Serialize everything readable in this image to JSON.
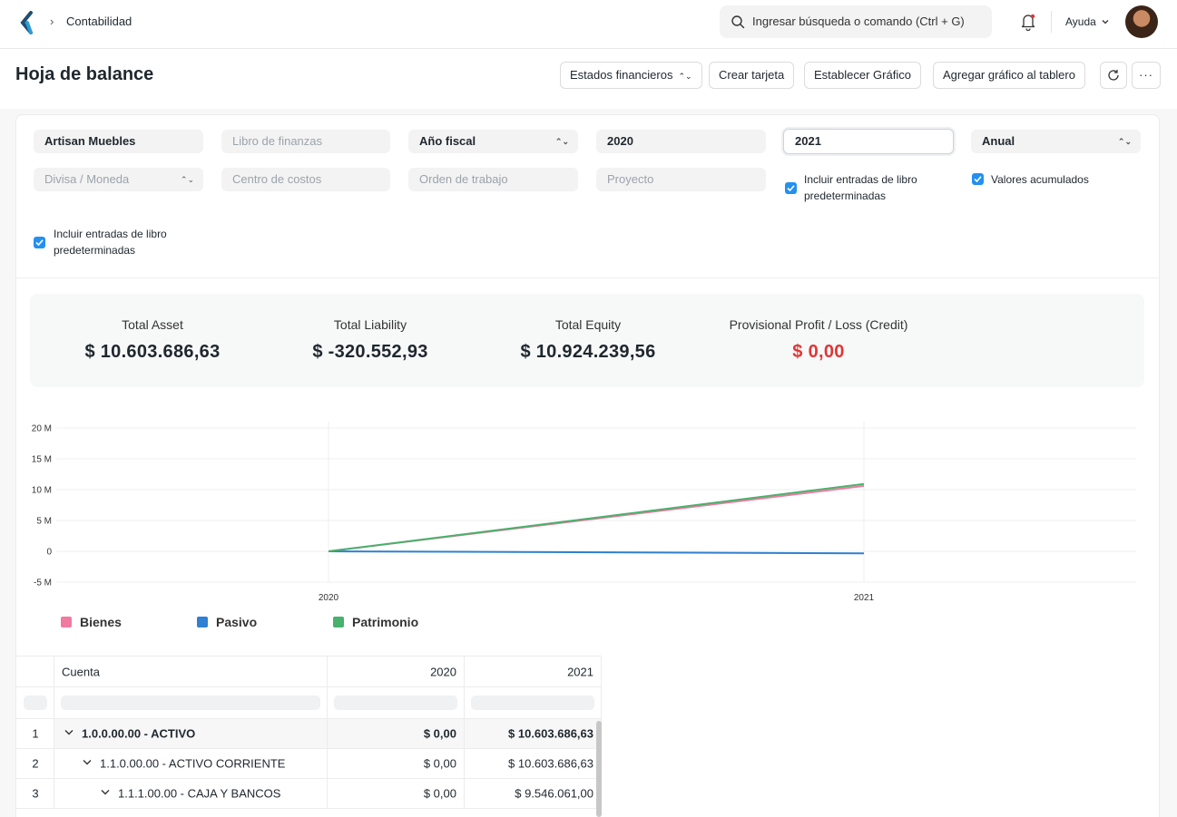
{
  "navbar": {
    "breadcrumb": "Contabilidad",
    "search_placeholder": "Ingresar búsqueda o comando (Ctrl + G)",
    "help_label": "Ayuda"
  },
  "page": {
    "title": "Hoja de balance",
    "buttons": {
      "financial_statements": "Estados financieros",
      "create_card": "Crear tarjeta",
      "set_chart": "Establecer Gráfico",
      "add_chart_dashboard": "Agregar gráfico al tablero"
    }
  },
  "filters": {
    "company": "Artisan Muebles",
    "finance_book_placeholder": "Libro de finanzas",
    "period_type": "Año fiscal",
    "from_year": "2020",
    "to_year": "2021",
    "periodicity": "Anual",
    "currency_placeholder": "Divisa / Moneda",
    "cost_center_placeholder": "Centro de costos",
    "work_order_placeholder": "Orden de trabajo",
    "project_placeholder": "Proyecto",
    "include_default_entries_1": {
      "checked": true,
      "label_line1": "Incluir entradas de libro",
      "label_line2": "predeterminadas"
    },
    "accumulated_values": {
      "checked": true,
      "label": "Valores acumulados"
    },
    "include_default_entries_2": {
      "checked": true,
      "label_line1": "Incluir entradas de libro",
      "label_line2": "predeterminadas"
    }
  },
  "summary": [
    {
      "label": "Total Asset",
      "value": "$ 10.603.686,63",
      "color": "#1f272e"
    },
    {
      "label": "Total Liability",
      "value": "$ -320.552,93",
      "color": "#1f272e"
    },
    {
      "label": "Total Equity",
      "value": "$ 10.924.239,56",
      "color": "#1f272e"
    },
    {
      "label": "Provisional Profit / Loss (Credit)",
      "value": "$ 0,00",
      "color": "#e03636"
    }
  ],
  "chart_data": {
    "type": "line",
    "x": [
      "2020",
      "2021"
    ],
    "ylim": [
      -5000000,
      20000000
    ],
    "yticks": [
      {
        "value": 20000000,
        "label": "20 M"
      },
      {
        "value": 15000000,
        "label": "15 M"
      },
      {
        "value": 10000000,
        "label": "10 M"
      },
      {
        "value": 5000000,
        "label": "5 M"
      },
      {
        "value": 0,
        "label": "0"
      },
      {
        "value": -5000000,
        "label": "-5 M"
      }
    ],
    "series": [
      {
        "name": "Bienes",
        "color": "#f07aa0",
        "values": [
          0,
          10603686.63
        ]
      },
      {
        "name": "Pasivo",
        "color": "#2f80d1",
        "values": [
          0,
          -320552.93
        ]
      },
      {
        "name": "Patrimonio",
        "color": "#48b16c",
        "values": [
          0,
          10924239.56
        ]
      }
    ],
    "legend": "bottom-left",
    "grid": true
  },
  "table": {
    "headers": [
      "Cuenta",
      "2020",
      "2021"
    ],
    "rows": [
      {
        "num": "1",
        "account": "1.0.0.00.00 - ACTIVO",
        "y2020": "$ 0,00",
        "y2021": "$ 10.603.686,63",
        "level": 0,
        "bold": true
      },
      {
        "num": "2",
        "account": "1.1.0.00.00 - ACTIVO CORRIENTE",
        "y2020": "$ 0,00",
        "y2021": "$ 10.603.686,63",
        "level": 1,
        "bold": false
      },
      {
        "num": "3",
        "account": "1.1.1.00.00 - CAJA Y BANCOS",
        "y2020": "$ 0,00",
        "y2021": "$ 9.546.061,00",
        "level": 2,
        "bold": false
      }
    ]
  }
}
